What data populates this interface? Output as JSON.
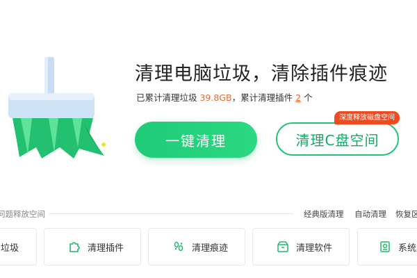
{
  "hero": {
    "headline": "清理电脑垃圾，清除插件痕迹",
    "stats": {
      "prefix": "已累计清理垃圾 ",
      "junk_size": "39.8GB",
      "middle": "，累计清理插件 ",
      "plugin_count": "2",
      "suffix": " 个"
    },
    "one_click_button": "一键清理",
    "clean_c_button": "清理C盘空间",
    "badge": "深度释放磁盘空间"
  },
  "tools": {
    "section_label": "问题释放空间",
    "links": [
      "经典版清理",
      "自动清理",
      "恢复区"
    ],
    "cards": [
      {
        "label": "垃圾",
        "icon": "trash-icon"
      },
      {
        "label": "清理插件",
        "icon": "puzzle-icon"
      },
      {
        "label": "清理痕迹",
        "icon": "footprint-icon"
      },
      {
        "label": "清理软件",
        "icon": "package-icon"
      },
      {
        "label": "系统盘",
        "icon": "disk-icon"
      }
    ]
  },
  "colors": {
    "accent_green": "#22c57a",
    "highlight_orange": "#f0672c",
    "badge_red": "#f04b1f"
  }
}
